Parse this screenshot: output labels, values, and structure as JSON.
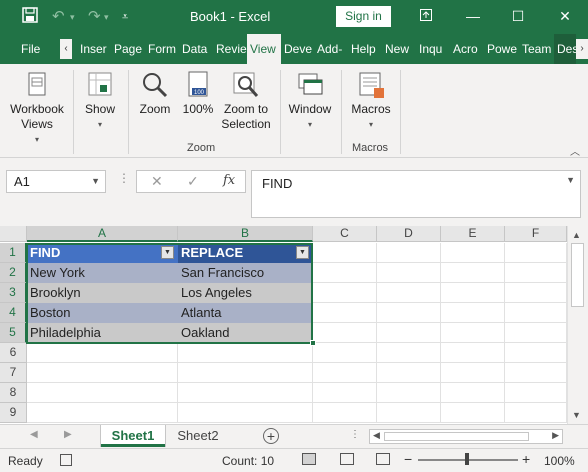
{
  "titlebar": {
    "save_icon": "save-icon",
    "title": "Book1  -  Excel",
    "signin": "Sign in",
    "accent": "#217346"
  },
  "tabs": [
    "File",
    "Inser",
    "Page",
    "Form",
    "Data",
    "Revie",
    "View",
    "Deve",
    "Add-",
    "Help",
    "New",
    "Inqu",
    "Acro",
    "Powe",
    "Team",
    "Des"
  ],
  "active_tab": "View",
  "ribbon": {
    "workbook_views": "Workbook Views",
    "show": "Show",
    "zoom": "Zoom",
    "zoom100": "100%",
    "zoom_to_selection": "Zoom to Selection",
    "zoom_group": "Zoom",
    "window": "Window",
    "macros": "Macros",
    "macros_group": "Macros"
  },
  "formula_bar": {
    "name_box": "A1",
    "fx": "fx",
    "content": "FIND"
  },
  "columns": [
    "A",
    "B",
    "C",
    "D",
    "E",
    "F"
  ],
  "rows": [
    "1",
    "2",
    "3",
    "4",
    "5",
    "6",
    "7",
    "8",
    "9"
  ],
  "table": {
    "headers": [
      "FIND",
      "REPLACE"
    ],
    "rows": [
      [
        "New York",
        "San Francisco"
      ],
      [
        "Brooklyn",
        "Los Angeles"
      ],
      [
        "Boston",
        "Atlanta"
      ],
      [
        "Philadelphia",
        "Oakland"
      ]
    ],
    "header_color": "#4472c4",
    "band_color_1": "#a9b1c7",
    "band_color_2": "#c9c9c9"
  },
  "sheets": [
    "Sheet1",
    "Sheet2"
  ],
  "active_sheet": "Sheet1",
  "status": {
    "ready": "Ready",
    "count": "Count: 10",
    "zoom": "100%"
  }
}
